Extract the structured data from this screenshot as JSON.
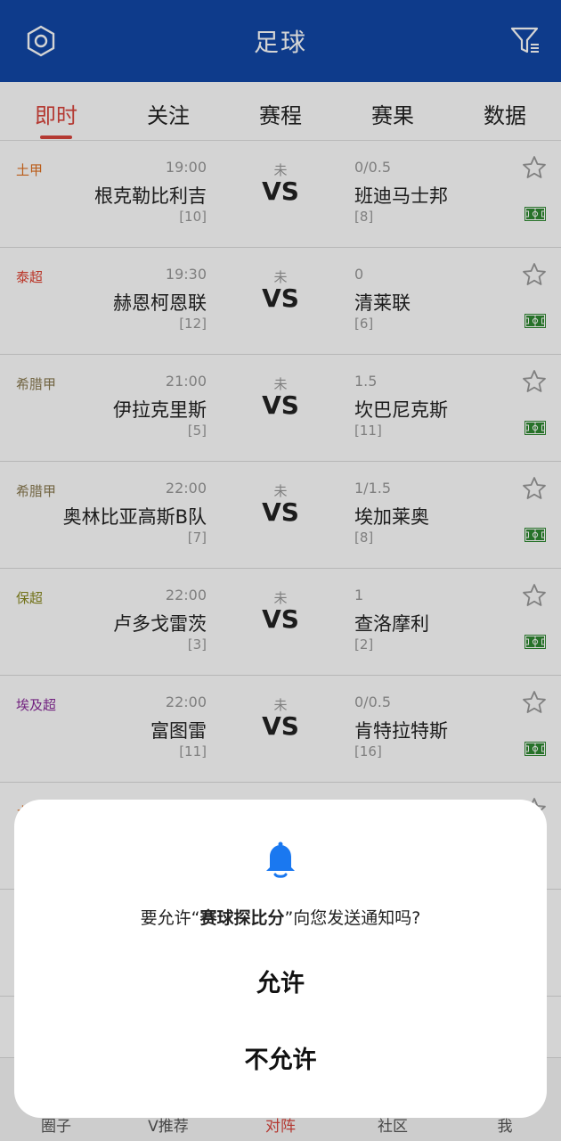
{
  "header": {
    "title": "足球"
  },
  "tabs": [
    {
      "label": "即时",
      "active": true
    },
    {
      "label": "关注"
    },
    {
      "label": "赛程"
    },
    {
      "label": "赛果"
    },
    {
      "label": "数据"
    }
  ],
  "matches": [
    {
      "league": "土甲",
      "league_color": "#e07020",
      "time": "19:00",
      "home": "根克勒比利吉",
      "home_rank": "[10]",
      "status": "未",
      "vs": "VS",
      "handicap": "0/0.5",
      "away": "班迪马士邦",
      "away_rank": "[8]"
    },
    {
      "league": "泰超",
      "league_color": "#e04030",
      "time": "19:30",
      "home": "赫恩柯恩联",
      "home_rank": "[12]",
      "status": "未",
      "vs": "VS",
      "handicap": "0",
      "away": "清莱联",
      "away_rank": "[6]"
    },
    {
      "league": "希腊甲",
      "league_color": "#8a7a50",
      "time": "21:00",
      "home": "伊拉克里斯",
      "home_rank": "[5]",
      "status": "未",
      "vs": "VS",
      "handicap": "1.5",
      "away": "坎巴尼克斯",
      "away_rank": "[11]"
    },
    {
      "league": "希腊甲",
      "league_color": "#8a7a50",
      "time": "22:00",
      "home": "奥林比亚高斯B队",
      "home_rank": "[7]",
      "status": "未",
      "vs": "VS",
      "handicap": "1/1.5",
      "away": "埃加莱奥",
      "away_rank": "[8]"
    },
    {
      "league": "保超",
      "league_color": "#8a8a20",
      "time": "22:00",
      "home": "卢多戈雷茨",
      "home_rank": "[3]",
      "status": "未",
      "vs": "VS",
      "handicap": "1",
      "away": "查洛摩利",
      "away_rank": "[2]"
    },
    {
      "league": "埃及超",
      "league_color": "#8a2a9a",
      "time": "22:00",
      "home": "富图雷",
      "home_rank": "[11]",
      "status": "未",
      "vs": "VS",
      "handicap": "0/0.5",
      "away": "肯特拉特斯",
      "away_rank": "[16]"
    },
    {
      "league": "土",
      "league_color": "#e07020",
      "time": "",
      "home": "",
      "home_rank": "",
      "status": "",
      "vs": "",
      "handicap": "",
      "away": "",
      "away_rank": ""
    },
    {
      "league": "",
      "league_color": "#999999",
      "time": "",
      "home": "",
      "home_rank": "",
      "status": "",
      "vs": "",
      "handicap": "",
      "away": "",
      "away_rank": ""
    }
  ],
  "bottom_nav": [
    {
      "label": "圈子"
    },
    {
      "label": "V推荐"
    },
    {
      "label": "对阵",
      "active": true
    },
    {
      "label": "社区"
    },
    {
      "label": "我"
    }
  ],
  "dialog": {
    "message_prefix": "要允许“",
    "app_name": "赛球探比分",
    "message_suffix": "”向您发送通知吗?",
    "allow_label": "允许",
    "deny_label": "不允许"
  },
  "colors": {
    "header_bg": "#1148a8",
    "accent": "#d9453d",
    "bell": "#1a78f0",
    "pitch": "#2f8a32"
  },
  "icons": [
    "settings-icon",
    "filter-icon",
    "star-icon",
    "pitch-icon",
    "bell-icon"
  ]
}
